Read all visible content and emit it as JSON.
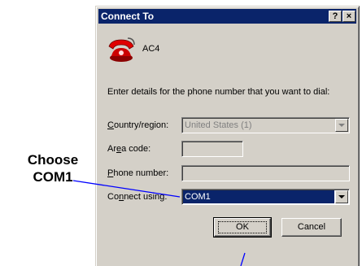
{
  "dialog": {
    "title": "Connect To",
    "help_button": "?",
    "close_button": "×",
    "connection_name": "AC4",
    "description": "Enter details for the phone number that you want to dial:",
    "country_label_prefix": "C",
    "country_label_rest": "ountry/region:",
    "country_value": "United States (1)",
    "area_label_prefix": "Ar",
    "area_label_accel": "e",
    "area_label_rest": "a code:",
    "area_value": "",
    "phone_label_prefix": "P",
    "phone_label_rest": "hone number:",
    "phone_value": "",
    "connect_label_prefix": "Co",
    "connect_label_accel": "n",
    "connect_label_rest": "nect using:",
    "connect_value": "COM1",
    "ok_label": "OK",
    "cancel_label": "Cancel"
  },
  "annotation": {
    "line1": "Choose",
    "line2": "COM1"
  },
  "icons": {
    "phone": "telephone-icon",
    "dropdown": "chevron-down-icon"
  },
  "colors": {
    "titlebar": "#0a246a",
    "dialog_bg": "#d4d0c8",
    "selection": "#0a246a"
  }
}
